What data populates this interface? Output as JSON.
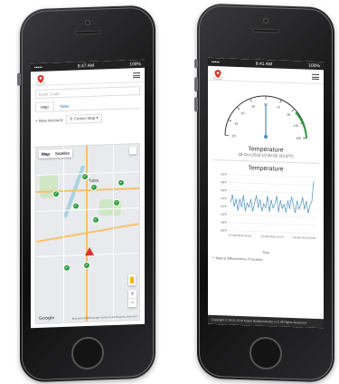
{
  "left_phone": {
    "status": {
      "carrier": "•••••",
      "time": "8:47 AM",
      "battery": "100%"
    },
    "search": {
      "placeholder": "Enter Code"
    },
    "tabs": [
      {
        "label": "Map"
      },
      {
        "label": "Table"
      }
    ],
    "toolbar": {
      "new_account": "New Account",
      "center_map": "Center Map ▾"
    },
    "map": {
      "types": [
        {
          "label": "Map"
        },
        {
          "label": "Satellite"
        }
      ],
      "city_label": "Tulsa",
      "google": "Google",
      "credit": "Map data ©2016 Google   Terms of Use   Report a map error",
      "zoom_in": "+",
      "zoom_out": "−"
    }
  },
  "right_phone": {
    "status": {
      "carrier": "•••••",
      "time": "8:41 AM",
      "battery": "100%"
    },
    "gauge": {
      "title": "Temperature",
      "subtitle": "18-Oct-2016  10:30:00 (43.8°F)",
      "ticks": [
        "-30",
        "-10",
        "10",
        "30",
        "50",
        "70",
        "90",
        "110",
        "130"
      ]
    },
    "chart_data": {
      "type": "line",
      "title": "Temperature",
      "xlabel": "Time",
      "ylabel": "",
      "x_ticks": [
        "15-Oct-2016 16:00",
        "16-Oct-2016 16:00",
        "18-Oct-2016 10:00"
      ],
      "y_ticks": [
        "50°F",
        "48°F",
        "46°F",
        "44°F",
        "42°F",
        "40°F",
        "38°F",
        "36°F"
      ],
      "ylim": [
        36,
        50
      ],
      "series": [
        {
          "values": [
            43,
            45,
            42,
            44,
            41,
            44,
            42,
            45,
            41,
            43,
            42,
            44,
            41,
            43,
            45,
            42,
            44,
            41,
            43,
            42,
            45,
            41,
            44,
            42,
            43,
            45,
            41,
            44,
            42,
            43,
            41,
            44,
            42,
            45,
            43,
            41,
            44,
            42,
            43,
            45,
            42,
            44,
            41,
            43,
            44,
            49
          ]
        }
      ]
    },
    "footnote": "** Data at different times (*) location",
    "footer": "Copyright © 2015, 2016 Kapco Biolaboratories LLC All Rights Reserved",
    "colors": {
      "needle": "#4a8fc2",
      "arc": "#333333",
      "line": "#4a8fc2"
    }
  }
}
